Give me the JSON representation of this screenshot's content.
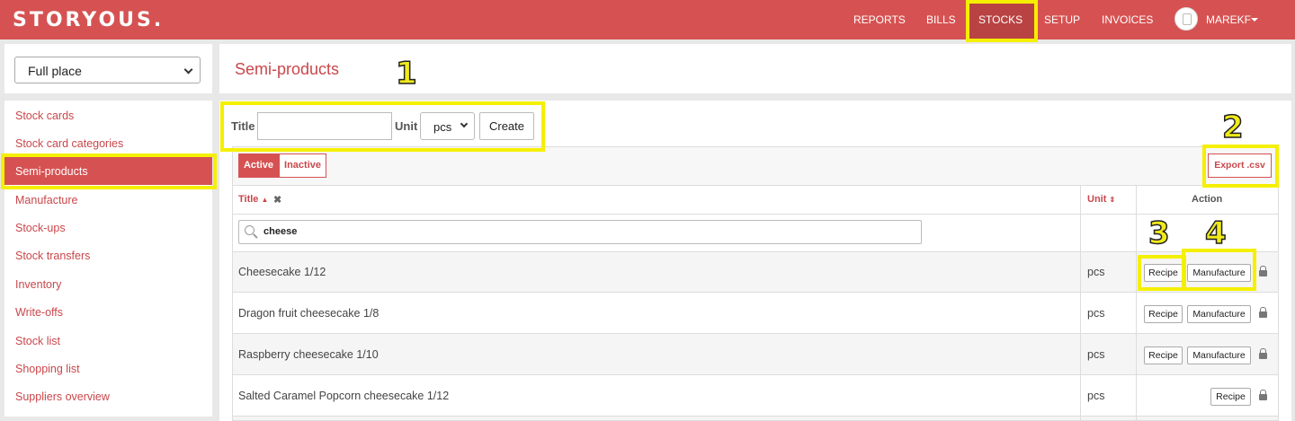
{
  "header": {
    "logo": "STORYOUS.",
    "nav": [
      "REPORTS",
      "BILLS",
      "STOCKS",
      "SETUP",
      "INVOICES"
    ],
    "user": "MAREKF"
  },
  "sidebar": {
    "place_select": "Full place",
    "items": [
      "Stock cards",
      "Stock card categories",
      "Semi-products",
      "Manufacture",
      "Stock-ups",
      "Stock transfers",
      "Inventory",
      "Write-offs",
      "Stock list",
      "Shopping list",
      "Suppliers overview"
    ]
  },
  "page": {
    "title": "Semi-products"
  },
  "form": {
    "title_label": "Title",
    "title_value": "",
    "unit_label": "Unit",
    "unit_value": "pcs",
    "create_label": "Create"
  },
  "filters": {
    "active": "Active",
    "inactive": "Inactive",
    "export": "Export .csv"
  },
  "table": {
    "columns": {
      "title": "Title",
      "unit": "Unit",
      "action": "Action"
    },
    "search_value": "cheese",
    "rows": [
      {
        "title": "Cheesecake 1/12",
        "unit": "pcs",
        "recipe": "Recipe",
        "manufacture": "Manufacture"
      },
      {
        "title": "Dragon fruit cheesecake 1/8",
        "unit": "pcs",
        "recipe": "Recipe",
        "manufacture": "Manufacture"
      },
      {
        "title": "Raspberry cheesecake 1/10",
        "unit": "pcs",
        "recipe": "Recipe",
        "manufacture": "Manufacture"
      },
      {
        "title": "Salted Caramel Popcorn cheesecake 1/12",
        "unit": "pcs",
        "recipe": "Recipe"
      }
    ]
  },
  "annotations": [
    "1",
    "2",
    "3",
    "4"
  ],
  "colors": {
    "brand": "#d65252",
    "highlight": "#f5ef00",
    "link": "#c9474b"
  }
}
